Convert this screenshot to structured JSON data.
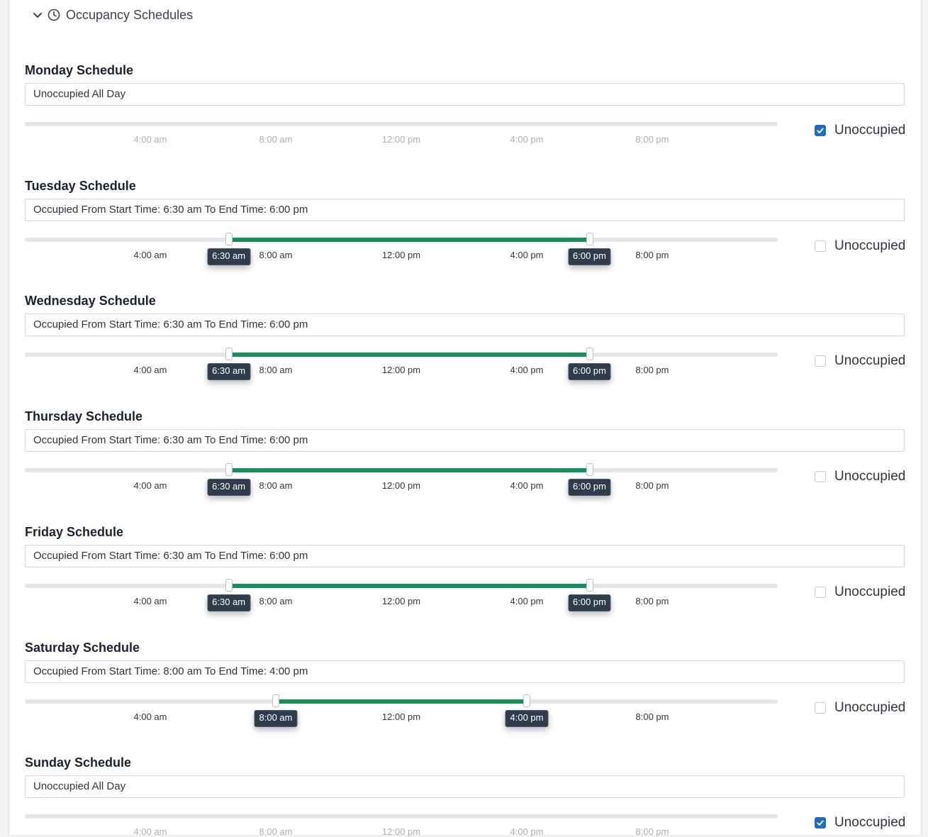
{
  "section": {
    "title": "Occupancy Schedules",
    "icon": "clock-icon",
    "toggle_icon": "chevron-down-icon"
  },
  "ticks": [
    "4:00 am",
    "8:00 am",
    "12:00 pm",
    "4:00 pm",
    "8:00 pm"
  ],
  "colors": {
    "occupied_fill": "#159158",
    "checkbox_checked": "#1f6fb8",
    "bubble_bg": "#2f3c4b"
  },
  "checkbox_label": "Unoccupied",
  "days": [
    {
      "title": "Monday Schedule",
      "summary": "Unoccupied All Day",
      "unoccupied": true,
      "start": "",
      "end": ""
    },
    {
      "title": "Tuesday Schedule",
      "summary": "Occupied From Start Time: 6:30 am To End Time: 6:00 pm",
      "unoccupied": false,
      "start": "6:30 am",
      "end": "6:00 pm"
    },
    {
      "title": "Wednesday Schedule",
      "summary": "Occupied From Start Time: 6:30 am To End Time: 6:00 pm",
      "unoccupied": false,
      "start": "6:30 am",
      "end": "6:00 pm"
    },
    {
      "title": "Thursday Schedule",
      "summary": "Occupied From Start Time: 6:30 am To End Time: 6:00 pm",
      "unoccupied": false,
      "start": "6:30 am",
      "end": "6:00 pm"
    },
    {
      "title": "Friday Schedule",
      "summary": "Occupied From Start Time: 6:30 am To End Time: 6:00 pm",
      "unoccupied": false,
      "start": "6:30 am",
      "end": "6:00 pm"
    },
    {
      "title": "Saturday Schedule",
      "summary": "Occupied From Start Time: 8:00 am To End Time: 4:00 pm",
      "unoccupied": false,
      "start": "8:00 am",
      "end": "4:00 pm"
    },
    {
      "title": "Sunday Schedule",
      "summary": "Unoccupied All Day",
      "unoccupied": true,
      "start": "",
      "end": ""
    }
  ]
}
